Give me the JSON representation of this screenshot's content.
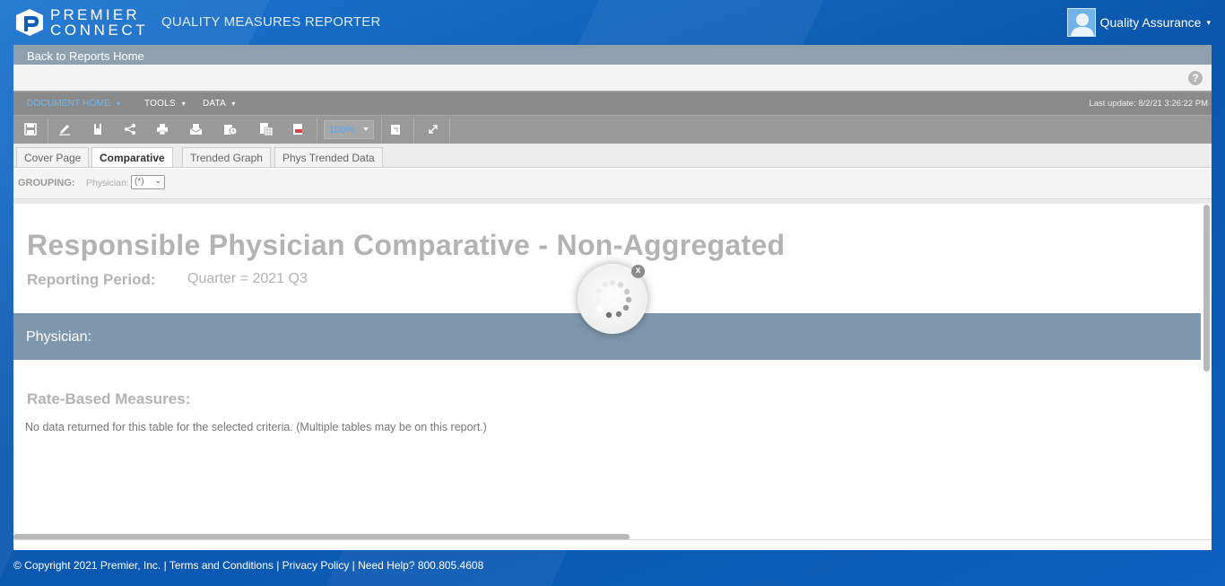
{
  "header": {
    "brand_line1": "PREMIER",
    "brand_line2": "CONNECT",
    "app_title": "QUALITY MEASURES REPORTER",
    "user_name": "Quality Assurance",
    "user_caret": "▾"
  },
  "nav": {
    "back_label": "Back to Reports Home"
  },
  "menu": {
    "items": [
      {
        "label": "DOCUMENT HOME",
        "caret": "▾"
      },
      {
        "label": "TOOLS",
        "caret": "▾"
      },
      {
        "label": "DATA",
        "caret": "▾"
      }
    ],
    "last_update": "Last update: 8/2/21 3:26:22 PM"
  },
  "toolbar": {
    "icons": [
      "save-icon",
      "edit-icon",
      "bookmark-icon",
      "share-icon",
      "print-icon",
      "email-icon",
      "schedule-icon",
      "export-excel-icon",
      "export-pdf-icon",
      "zoom-select",
      "refresh-icon",
      "fullscreen-icon"
    ],
    "zoom_value": "100%"
  },
  "tabs": [
    {
      "label": "Cover Page",
      "active": false
    },
    {
      "label": "Comparative",
      "active": true
    },
    {
      "label": "Trended Graph",
      "active": false
    },
    {
      "label": "Phys Trended Data",
      "active": false
    }
  ],
  "grouping": {
    "label": "GROUPING:",
    "physician_label": "Physician:",
    "physician_value": "(*)"
  },
  "report": {
    "title": "Responsible Physician Comparative - Non-Aggregated",
    "period_label": "Reporting Period:",
    "period_value": "Quarter = 2021 Q3",
    "physician_band": "Physician:",
    "rate_title": "Rate-Based Measures:",
    "no_data": "No data returned for this table for the selected criteria. (Multiple tables may be on this report.)"
  },
  "loading": {
    "close_label": "x"
  },
  "footer": {
    "text": "© Copyright 2021 Premier, Inc. | Terms and Conditions | Privacy Policy | Need Help? 800.805.4608"
  },
  "colors": {
    "background": "#0d5fb8",
    "accent": "#6fb8f0",
    "band": "#7f97ad"
  }
}
